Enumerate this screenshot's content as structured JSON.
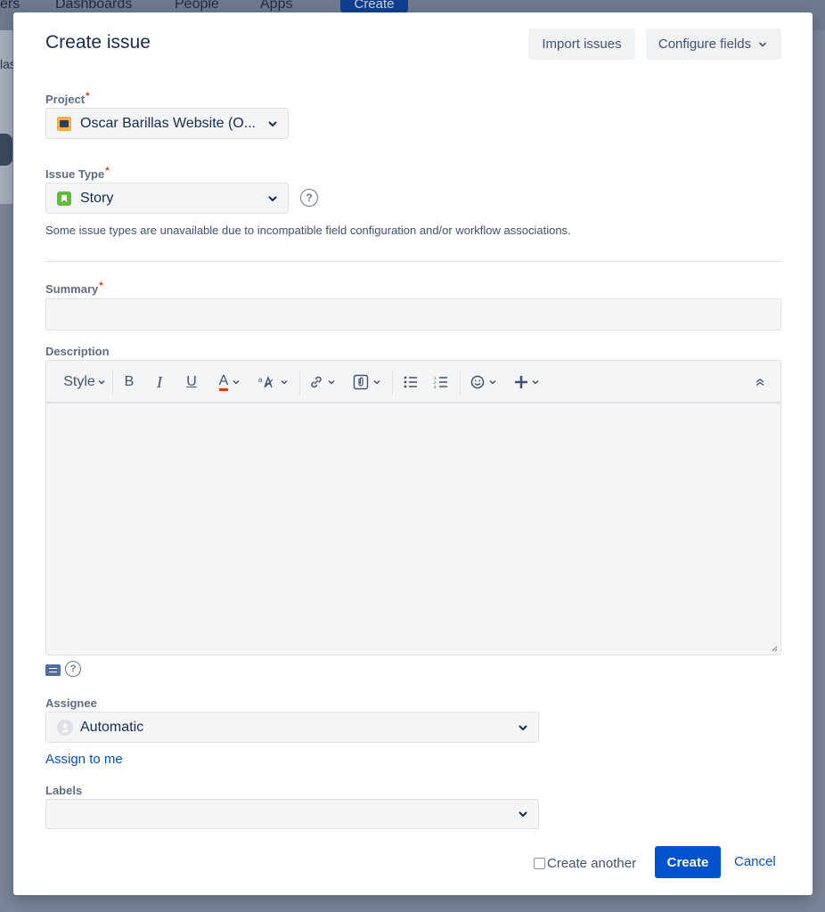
{
  "background": {
    "nav_items": [
      "ers",
      "Dashboards",
      "People",
      "Apps"
    ],
    "nav_create_label": "Create",
    "fragment_text": "las"
  },
  "dialog": {
    "title": "Create issue",
    "import_label": "Import issues",
    "configure_label": "Configure fields"
  },
  "fields": {
    "project": {
      "label": "Project",
      "required_marker": "*",
      "value": "Oscar Barillas Website (O..."
    },
    "issue_type": {
      "label": "Issue Type",
      "required_marker": "*",
      "value": "Story",
      "note": "Some issue types are unavailable due to incompatible field configuration and/or workflow associations."
    },
    "summary": {
      "label": "Summary",
      "required_marker": "*",
      "value": ""
    },
    "description": {
      "label": "Description",
      "toolbar": {
        "style_label": "Style",
        "bold": "B",
        "italic": "I",
        "underline": "U",
        "text_color": "A"
      }
    },
    "assignee": {
      "label": "Assignee",
      "value": "Automatic",
      "assign_to_me_label": "Assign to me"
    },
    "labels": {
      "label": "Labels",
      "value": ""
    }
  },
  "footer": {
    "create_another_label": "Create another",
    "create_label": "Create",
    "cancel_label": "Cancel"
  },
  "colors": {
    "primary": "#0052cc",
    "required": "#de350b",
    "field_bg": "#f4f5f7"
  }
}
